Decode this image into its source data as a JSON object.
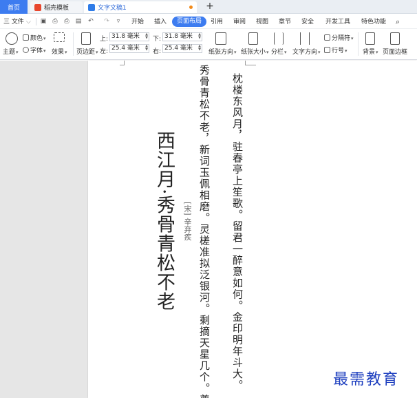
{
  "tabs": {
    "home": "首页",
    "template": "稻壳模板",
    "document": "文字文稿1",
    "add": "+"
  },
  "menu": {
    "file": "三 文件",
    "items": [
      "开始",
      "插入",
      "页面布局",
      "引用",
      "审阅",
      "视图",
      "章节",
      "安全",
      "开发工具",
      "特色功能"
    ],
    "active_index": 2,
    "search_icon": "search-icon"
  },
  "ribbon": {
    "theme": "主题",
    "color": "颜色",
    "font": "字体",
    "effect": "效果",
    "margin": "页边距",
    "top_label": "上:",
    "top_value": "31.8 毫米",
    "bottom_label": "下:",
    "bottom_value": "31.8 毫米",
    "left_label": "左:",
    "left_value": "25.4 毫米",
    "right_label": "右:",
    "right_value": "25.4 毫米",
    "orientation": "纸张方向",
    "size": "纸张大小",
    "columns": "分栏",
    "text_direction": "文字方向",
    "separator": "分隔符",
    "line_number": "行号",
    "background": "背景",
    "page_border": "页面边框"
  },
  "document": {
    "title": "西江月·秀骨青松不老",
    "author": "[宋] 辛弃疾",
    "verse_line_1": "枕楼东风月，驻春亭上笙歌。留君一醉意如何。金印明年斗大。",
    "verse_line_1b": "",
    "verse_line_2": "秀骨青松不老，新词玉佩相磨。灵槎准拟泛银河。剩摘天星几个。奠"
  },
  "watermark": "最需教育",
  "colors": {
    "accent": "#3d7cf0",
    "watermark": "#1e3fbf",
    "workspace": "#e6e6e6"
  }
}
